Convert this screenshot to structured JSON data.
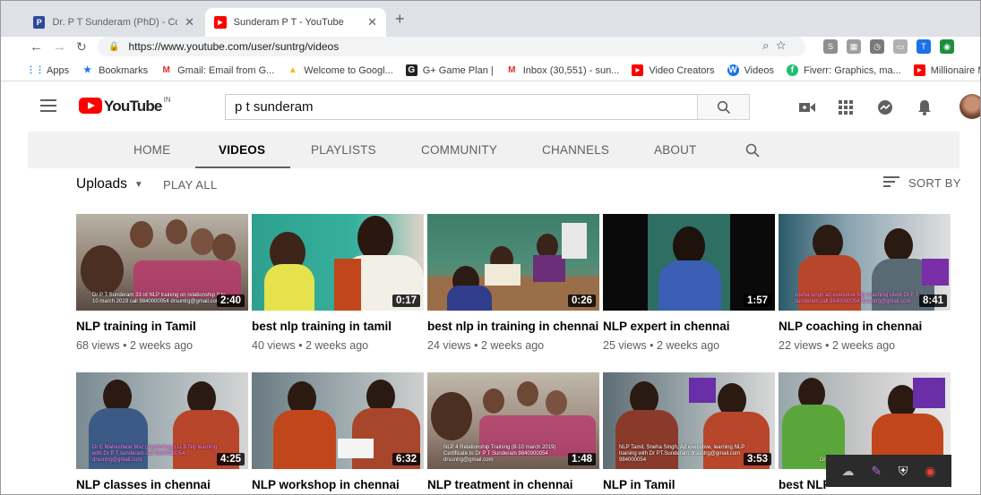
{
  "browser": {
    "tabs": [
      {
        "title": "Dr. P T Sunderam (PhD) - Counse",
        "favicon": "P",
        "active": false
      },
      {
        "title": "Sunderam P T - YouTube",
        "favicon": "▶",
        "active": true
      }
    ],
    "url": "https://www.youtube.com/user/suntrg/videos",
    "bookmarks": [
      {
        "label": "Apps",
        "icon": "apps-grid-icon"
      },
      {
        "label": "Bookmarks",
        "icon": "star-icon"
      },
      {
        "label": "Gmail: Email from G...",
        "icon": "gmail-icon"
      },
      {
        "label": "Welcome to Googl...",
        "icon": "google-drive-icon"
      },
      {
        "label": "G+ Game Plan |",
        "icon": "gplus-icon"
      },
      {
        "label": "Inbox (30,551) - sun...",
        "icon": "gmail-icon"
      },
      {
        "label": "Video Creators",
        "icon": "youtube-icon"
      },
      {
        "label": "Videos",
        "icon": "videos-icon"
      },
      {
        "label": "Fiverr: Graphics, ma...",
        "icon": "fiverr-icon"
      },
      {
        "label": "Millionaire Mind -...",
        "icon": "youtube-icon"
      }
    ]
  },
  "youtube": {
    "logo_text": "YouTube",
    "country": "IN",
    "search_value": "p t sunderam",
    "channel_tabs": [
      "HOME",
      "VIDEOS",
      "PLAYLISTS",
      "COMMUNITY",
      "CHANNELS",
      "ABOUT"
    ],
    "active_tab": "VIDEOS",
    "uploads_label": "Uploads",
    "play_all": "PLAY ALL",
    "sort_by": "SORT BY",
    "videos": [
      {
        "title": "NLP training in Tamil",
        "meta": "68 views • 2 weeks ago",
        "duration": "2:40",
        "caption": "Dr P T Sunderam 33 rd NLP training on relationship 8 to 10 march 2019 call 9840000054 drsuntrg@gmail.com"
      },
      {
        "title": "best nlp training in tamil",
        "meta": "40 views • 2 weeks ago",
        "duration": "0:17",
        "caption": ""
      },
      {
        "title": "best nlp in training in chennai",
        "meta": "24 views • 2 weeks ago",
        "duration": "0:26",
        "caption": ""
      },
      {
        "title": "NLP expert in chennai",
        "meta": "25 views • 2 weeks ago",
        "duration": "1:57",
        "caption": ""
      },
      {
        "title": "NLP coaching in chennai",
        "meta": "22 views • 2 weeks ago",
        "duration": "8:41",
        "caption": "sneha singh ad executive Nlp coaching client Dr P T sunderam call 9840000054 drsuntrg@gmail.com"
      },
      {
        "title": "NLP classes in chennai",
        "meta": "",
        "duration": "4:25",
        "caption": "Dr E Maheshwar Msc (psychology) LLB Nlp learning with Dr P T sunderam call 9840000054 drsuntrg@gmail.com"
      },
      {
        "title": "NLP workshop in chennai",
        "meta": "",
        "duration": "6:32",
        "caption": ""
      },
      {
        "title": "NLP treatment in chennai",
        "meta": "",
        "duration": "1:48",
        "caption": "NLP 4 Relationship Training (8-10 march 2019) Certificate to Dr P T Sunderam 9840000054 drsuntrg@gmail.com"
      },
      {
        "title": "NLP in Tamil",
        "meta": "",
        "duration": "3:53",
        "caption": "NLP Tamil, Sneha Singh, Ad executive, learning NLP training with Dr PT.Sunderam drsuntrg@gmail.com 984000054"
      },
      {
        "title": "best NLP",
        "meta": "",
        "duration": "",
        "caption": "Dr"
      }
    ]
  }
}
